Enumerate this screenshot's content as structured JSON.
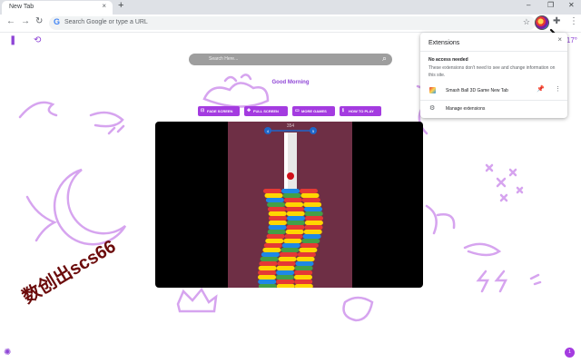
{
  "browser": {
    "tab_title": "New Tab",
    "tab_close": "×",
    "new_tab": "+",
    "window_controls": {
      "minimize": "–",
      "restore": "❐",
      "close": "✕"
    },
    "omnibox_placeholder": "Search Google or type a URL"
  },
  "page": {
    "search_placeholder": "Search Here...",
    "greeting": "Good Morning",
    "weather": "17°",
    "buttons": [
      {
        "label": "FADE SCREEN",
        "icon": "⊡"
      },
      {
        "label": "FULL SCREEN",
        "icon": "✥"
      },
      {
        "label": "MORE GAMES",
        "icon": "▭"
      },
      {
        "label": "HOW TO PLAY",
        "icon": "ℹ"
      }
    ],
    "game": {
      "title": "Smash Ball 3D Game",
      "level_left": "4",
      "level_right": "5",
      "score": "354"
    },
    "watermark": "数创出scs66",
    "corner_badge": "1"
  },
  "extensions_popup": {
    "title": "Extensions",
    "close": "×",
    "section_title": "No access needed",
    "section_desc": "These extensions don't need to see and change information on this site.",
    "extension_name": "Smash Ball 3D Game New Tab",
    "manage_label": "Manage extensions"
  },
  "colors": {
    "accent": "#a43be0",
    "decor": "#d6a4ef",
    "game_bg": "#6e2f45",
    "watermark": "#6b0a0a"
  }
}
